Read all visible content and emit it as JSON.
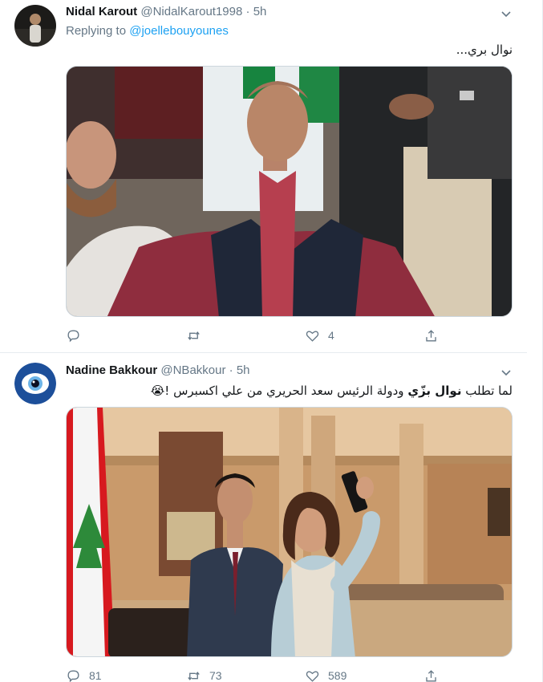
{
  "tweets": [
    {
      "name": "Nidal Karout",
      "handle": "@NidalKarout1998",
      "dot": "·",
      "time": "5h",
      "replying_prefix": "Replying to ",
      "replying_to": "@joellebouyounes",
      "text": "نوال بري...",
      "stats": {
        "replies": "",
        "retweets": "",
        "likes": "4"
      }
    },
    {
      "name": "Nadine Bakkour",
      "handle": "@NBakkour",
      "dot": "·",
      "time": "5h",
      "text_prefix": "لما تطلب ",
      "text_bold": "نوال بزّي",
      "text_suffix": " ودولة الرئيس سعد الحريري من علي اكسبرس !",
      "emoji": "😭",
      "stats": {
        "replies": "81",
        "retweets": "73",
        "likes": "589"
      }
    }
  ],
  "colors": {
    "accent": "#1da1f2",
    "secondary_text": "#657786",
    "border": "#e6ecf0"
  },
  "icons": [
    "reply-icon",
    "retweet-icon",
    "like-icon",
    "share-icon",
    "chevron-down-icon"
  ]
}
